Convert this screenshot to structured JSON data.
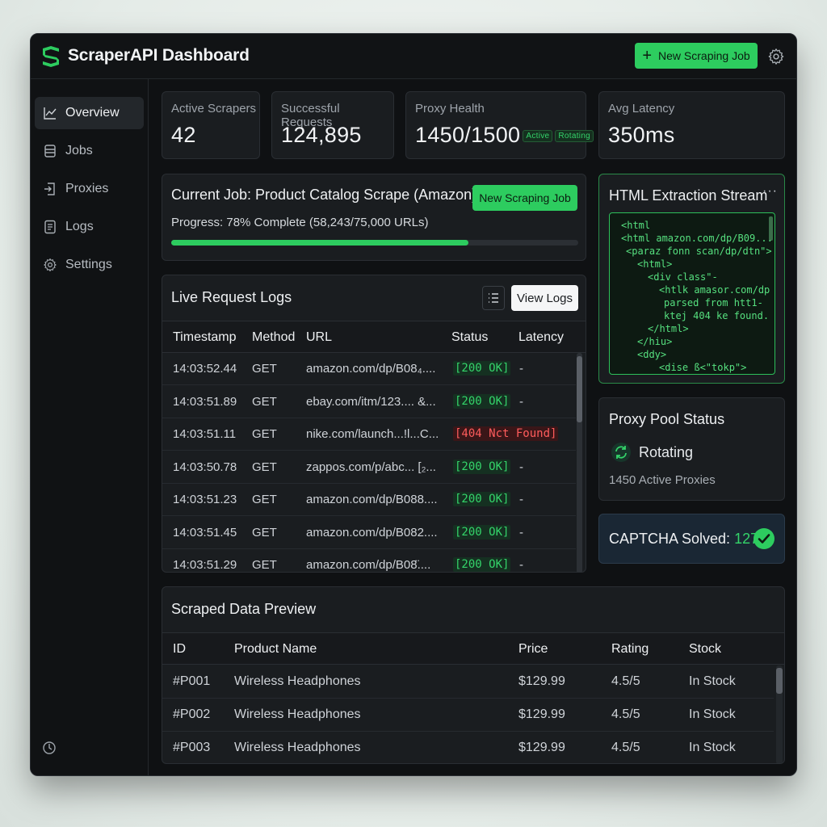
{
  "app": {
    "title": "ScraperAPI Dashboard",
    "new_job_label": "New Scraping Job"
  },
  "sidebar": {
    "items": [
      {
        "label": "Overview",
        "icon": "chart-line-icon",
        "active": true
      },
      {
        "label": "Jobs",
        "icon": "layers-icon"
      },
      {
        "label": "Proxies",
        "icon": "proxy-icon"
      },
      {
        "label": "Logs",
        "icon": "document-icon"
      },
      {
        "label": "Settings",
        "icon": "gear-icon"
      }
    ],
    "bottom_icons": [
      "history-icon",
      "gear-icon"
    ]
  },
  "stats": {
    "active_scrapers": {
      "label": "Active Scrapers",
      "value": "42"
    },
    "successful_requests": {
      "label": "Successful Requests",
      "value": "124,895"
    },
    "proxy_health": {
      "label": "Proxy Health",
      "value": "1450/1500",
      "badges": [
        "Active",
        "Rotating"
      ]
    },
    "avg_latency": {
      "label": "Avg Latency",
      "value": "350ms"
    }
  },
  "current_job": {
    "title": "Current Job: Product Catalog Scrape (Amazon)",
    "button_label": "New Scraping Job",
    "progress_text": "Progress: 78% Complete (58,243/75,000 URLs)",
    "progress_fraction": 0.73
  },
  "logs": {
    "title": "Live Request Logs",
    "view_logs_label": "View Logs",
    "columns": [
      "Timestamp",
      "Method",
      "URL",
      "Status",
      "Latency"
    ],
    "rows": [
      {
        "time": "14:03:52.44",
        "method": "GET",
        "url": "amazon.com/dp/B08₄....",
        "status": "[200 OK]",
        "ok": true,
        "latency": "-"
      },
      {
        "time": "14:03:51.89",
        "method": "GET",
        "url": "ebay.com/itm/123.... &...",
        "status": "[200 OK]",
        "ok": true,
        "latency": "-"
      },
      {
        "time": "14:03:51.11",
        "method": "GET",
        "url": "nike.com/launch...!l...C...",
        "status": "[404 Nct Found]",
        "ok": false,
        "latency": ""
      },
      {
        "time": "14:03:50.78",
        "method": "GET",
        "url": "zappos.com/p/abc... [₂...",
        "status": "[200 OK]",
        "ok": true,
        "latency": "-"
      },
      {
        "time": "14:03:51.23",
        "method": "GET",
        "url": "amazon.com/dp/B088....",
        "status": "[200 OK]",
        "ok": true,
        "latency": "-"
      },
      {
        "time": "14:03:51.45",
        "method": "GET",
        "url": "amazon.com/dp/B082....",
        "status": "[200 OK]",
        "ok": true,
        "latency": "-"
      },
      {
        "time": "14:03:51.29",
        "method": "GET",
        "url": "amazon.com/dp/B08̈....",
        "status": "[200 OK]",
        "ok": true,
        "latency": "-"
      }
    ]
  },
  "html_stream": {
    "title": "HTML Extraction Stream",
    "lines": [
      "<html",
      "<html amazon.com/dp/B09...",
      "<paraz fonn scan/dp/dtn\">",
      "<html>",
      "<div class\"-",
      "<htlk amasor.com/dp",
      "parsed from htt1-",
      "ktej 404 ke found.",
      "</html>",
      "</hiu>",
      "<ddy>",
      "<dise ß<\"tokp\">"
    ]
  },
  "proxy_pool": {
    "title": "Proxy Pool Status",
    "status": "Rotating",
    "active_text": "1450 Active Proxies"
  },
  "captcha": {
    "label": "CAPTCHA Solved:",
    "count": "127"
  },
  "scraped": {
    "title": "Scraped Data Preview",
    "columns": [
      "ID",
      "Product Name",
      "Price",
      "Rating",
      "Stock"
    ],
    "rows": [
      {
        "id": "#P001",
        "name": "Wireless Headphones",
        "price": "$129.99",
        "rating": "4.5/5",
        "stock": "In Stock"
      },
      {
        "id": "#P002",
        "name": "Wireless Headphones",
        "price": "$129.99",
        "rating": "4.5/5",
        "stock": "In Stock"
      },
      {
        "id": "#P003",
        "name": "Wireless Headphones",
        "price": "$129.99",
        "rating": "4.5/5",
        "stock": "In Stock"
      }
    ]
  },
  "colors": {
    "accent": "#2dcc5f",
    "background": "#0f1113",
    "card": "#1a1d20",
    "error": "#ff5c5c"
  }
}
